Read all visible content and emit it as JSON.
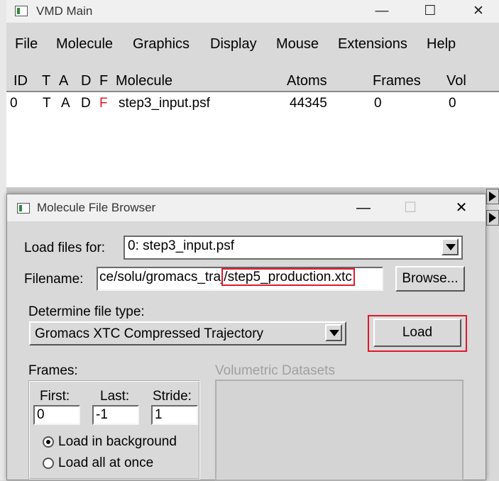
{
  "main_window": {
    "title": "VMD Main",
    "menu": [
      "File",
      "Molecule",
      "Graphics",
      "Display",
      "Mouse",
      "Extensions",
      "Help"
    ],
    "columns": {
      "id": "ID",
      "t": "T",
      "a": "A",
      "d": "D",
      "f": "F",
      "molecule": "Molecule",
      "atoms": "Atoms",
      "frames": "Frames",
      "vol": "Vol"
    },
    "rows": [
      {
        "id": "0",
        "t": "T",
        "a": "A",
        "d": "D",
        "f": "F",
        "molecule": "step3_input.psf",
        "atoms": "44345",
        "frames": "0",
        "vol": "0"
      }
    ],
    "window_controls": {
      "minimize": "—",
      "maximize": "☐",
      "close": "✕"
    }
  },
  "file_browser": {
    "title": "Molecule File Browser",
    "load_files_for_label": "Load files for:",
    "load_files_for_value": "0: step3_input.psf",
    "filename_label": "Filename:",
    "filename_prefix": "ce/solu/gromacs_traj",
    "filename_highlighted": "/step5_production.xtc",
    "browse_label": "Browse...",
    "determine_file_type_label": "Determine file type:",
    "file_type_value": "Gromacs XTC Compressed Trajectory",
    "load_button": "Load",
    "frames_label": "Frames:",
    "first_label": "First:",
    "first_value": "0",
    "last_label": "Last:",
    "last_value": "-1",
    "stride_label": "Stride:",
    "stride_value": "1",
    "load_background_label": "Load in background",
    "load_all_label": "Load all at once",
    "volumetric_label": "Volumetric Datasets",
    "window_controls": {
      "minimize": "—",
      "maximize": "☐",
      "close": "✕"
    }
  },
  "colors": {
    "highlight": "#e0192d",
    "f_flag": "#e0192d"
  }
}
